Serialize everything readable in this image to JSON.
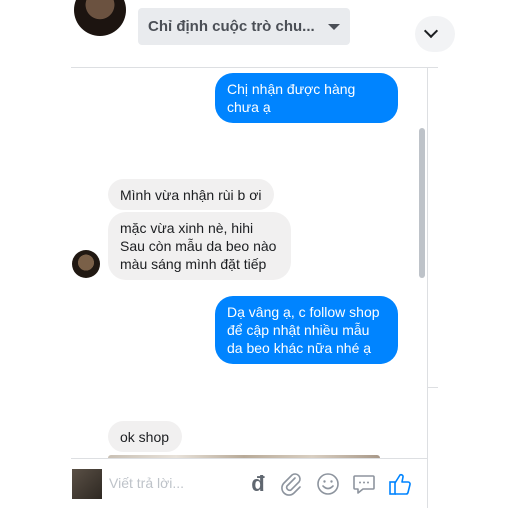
{
  "header": {
    "conversation_select": "Chỉ định cuộc trò chu..."
  },
  "messages": [
    {
      "side": "out",
      "lines": [
        "Chị nhận được hàng",
        "chưa ạ"
      ]
    },
    {
      "side": "in",
      "lines": [
        "Mình vừa nhận rùi b ơi"
      ]
    },
    {
      "side": "in",
      "lines": [
        "mặc vừa xinh nè, hihi",
        "Sau còn mẫu da beo nào",
        "màu sáng mình đặt tiếp"
      ]
    },
    {
      "side": "out",
      "lines": [
        "Dạ vâng ạ, c follow shop",
        "để cập nhật nhiều mẫu",
        "da beo khác nữa nhé ạ"
      ]
    },
    {
      "side": "in",
      "lines": [
        "ok shop"
      ]
    }
  ],
  "composer": {
    "placeholder": "Viết trả lời...",
    "tools": [
      "currency-dong-icon",
      "paperclip-icon",
      "emoji-icon",
      "chat-icon",
      "thumbs-up-icon"
    ]
  },
  "colors": {
    "outgoing": "#0084ff",
    "incoming": "#f1f0f0",
    "select_bg": "#e9ebee"
  }
}
